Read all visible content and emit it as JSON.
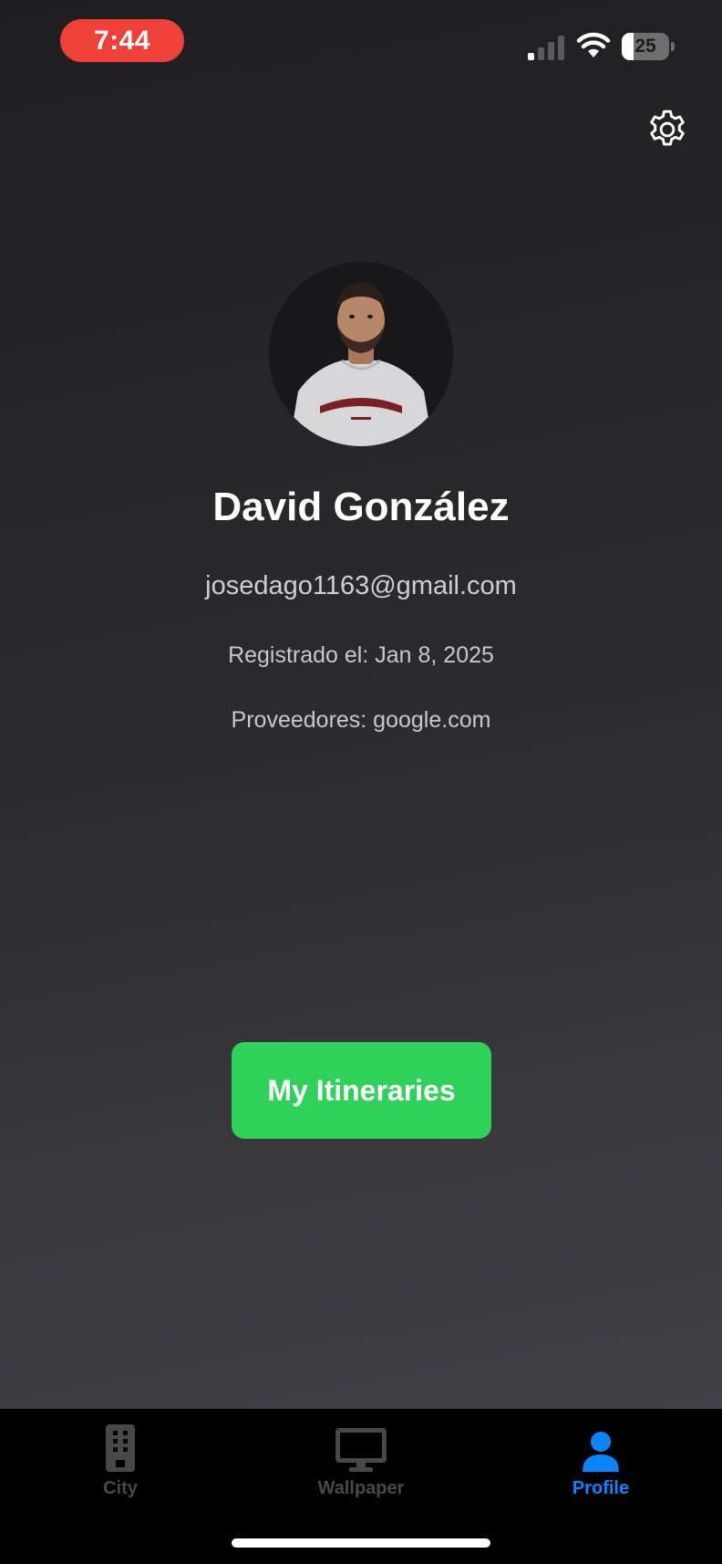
{
  "status_bar": {
    "time": "7:44",
    "battery_level": "25",
    "battery_fraction": 0.25,
    "signal_bars_active": 1,
    "signal_bars_total": 4,
    "icons": [
      "signal-icon",
      "wifi-icon",
      "battery-icon"
    ]
  },
  "header": {
    "settings_icon": "gear-icon"
  },
  "profile": {
    "avatar_icon": "user-photo",
    "name": "David González",
    "email": "josedago1163@gmail.com",
    "registered": "Registrado el: Jan 8, 2025",
    "providers": "Proveedores: google.com"
  },
  "actions": {
    "itineraries_label": "My Itineraries"
  },
  "tab_bar": {
    "items": [
      {
        "label": "City",
        "icon": "building-icon",
        "active": false
      },
      {
        "label": "Wallpaper",
        "icon": "monitor-icon",
        "active": false
      },
      {
        "label": "Profile",
        "icon": "person-icon",
        "active": true
      }
    ]
  },
  "colors": {
    "accent_blue": "#0a84ff",
    "button_green": "#30d158",
    "time_pill_red": "#ef4138",
    "inactive_tab": "#48484a"
  }
}
